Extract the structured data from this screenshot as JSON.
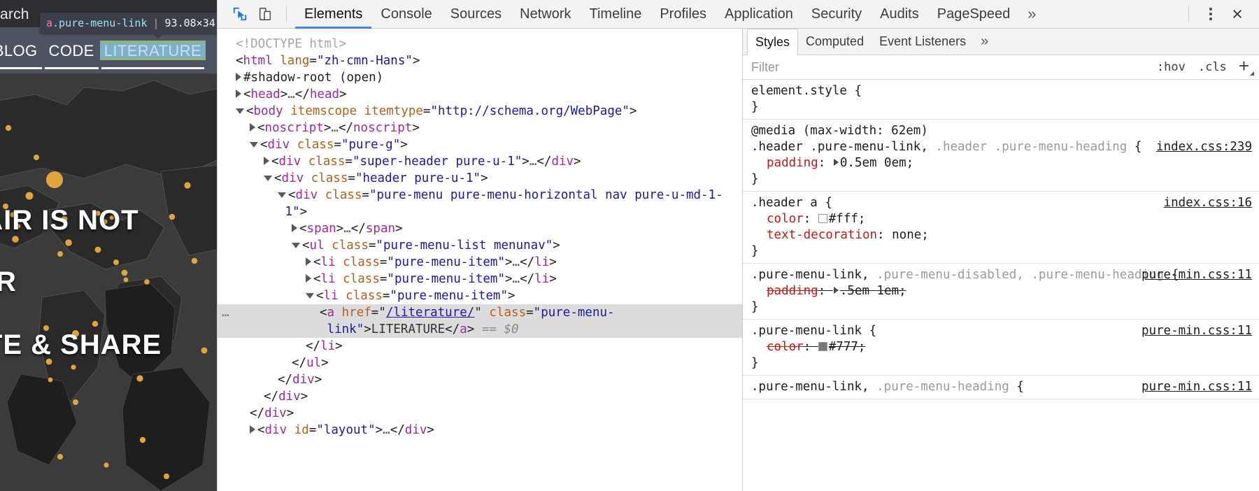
{
  "viewport": {
    "topbar": {
      "search_label": "arch"
    },
    "inspector_tooltip": {
      "tag": "a",
      "classname": ".pure-menu-link",
      "separator": "|",
      "size": "93.08×34"
    },
    "nav": [
      {
        "label": "BLOG",
        "highlighted": false
      },
      {
        "label": "CODE",
        "highlighted": false
      },
      {
        "label": "LITERATURE",
        "highlighted": true
      }
    ],
    "hero": {
      "line1": "FAIR IS NOT",
      "line2": "AIR",
      "line3": "ATE & SHARE"
    }
  },
  "devtools": {
    "toolbar": {
      "inspect_icon": "cursor-select-icon",
      "device_icon": "device-toolbar-icon",
      "tabs": [
        {
          "label": "Elements",
          "active": true
        },
        {
          "label": "Console",
          "active": false
        },
        {
          "label": "Sources",
          "active": false
        },
        {
          "label": "Network",
          "active": false
        },
        {
          "label": "Timeline",
          "active": false
        },
        {
          "label": "Profiles",
          "active": false
        },
        {
          "label": "Application",
          "active": false
        },
        {
          "label": "Security",
          "active": false
        },
        {
          "label": "Audits",
          "active": false
        },
        {
          "label": "PageSpeed",
          "active": false
        }
      ],
      "more_tabs": "»",
      "menu_icon": "kebab-menu-icon",
      "close_icon": "×"
    },
    "dom_tree": [
      {
        "indent": 0,
        "twisty": "none",
        "parts": [
          {
            "t": "doctype",
            "v": "<!DOCTYPE html>"
          }
        ]
      },
      {
        "indent": 0,
        "twisty": "none",
        "parts": [
          {
            "t": "punc",
            "v": "<"
          },
          {
            "t": "tag",
            "v": "html"
          },
          {
            "t": "sp",
            "v": " "
          },
          {
            "t": "attr",
            "v": "lang"
          },
          {
            "t": "punc",
            "v": "="
          },
          {
            "t": "val",
            "v": "\"zh-cmn-Hans\""
          },
          {
            "t": "punc",
            "v": ">"
          }
        ]
      },
      {
        "indent": 0,
        "twisty": "closed",
        "parts": [
          {
            "t": "plain",
            "v": "#shadow-root (open)"
          }
        ]
      },
      {
        "indent": 0,
        "twisty": "closed",
        "parts": [
          {
            "t": "punc",
            "v": "<"
          },
          {
            "t": "tag",
            "v": "head"
          },
          {
            "t": "punc",
            "v": ">"
          },
          {
            "t": "dots",
            "v": "…"
          },
          {
            "t": "punc",
            "v": "</"
          },
          {
            "t": "tag",
            "v": "head"
          },
          {
            "t": "punc",
            "v": ">"
          }
        ]
      },
      {
        "indent": 0,
        "twisty": "open",
        "parts": [
          {
            "t": "punc",
            "v": "<"
          },
          {
            "t": "tag",
            "v": "body"
          },
          {
            "t": "sp",
            "v": " "
          },
          {
            "t": "attr",
            "v": "itemscope"
          },
          {
            "t": "sp",
            "v": " "
          },
          {
            "t": "attr",
            "v": "itemtype"
          },
          {
            "t": "punc",
            "v": "="
          },
          {
            "t": "val",
            "v": "\"http://schema.org/WebPage\""
          },
          {
            "t": "punc",
            "v": ">"
          }
        ]
      },
      {
        "indent": 1,
        "twisty": "closed",
        "parts": [
          {
            "t": "punc",
            "v": "<"
          },
          {
            "t": "tag",
            "v": "noscript"
          },
          {
            "t": "punc",
            "v": ">"
          },
          {
            "t": "dots",
            "v": "…"
          },
          {
            "t": "punc",
            "v": "</"
          },
          {
            "t": "tag",
            "v": "noscript"
          },
          {
            "t": "punc",
            "v": ">"
          }
        ]
      },
      {
        "indent": 1,
        "twisty": "open",
        "parts": [
          {
            "t": "punc",
            "v": "<"
          },
          {
            "t": "tag",
            "v": "div"
          },
          {
            "t": "sp",
            "v": " "
          },
          {
            "t": "attr",
            "v": "class"
          },
          {
            "t": "punc",
            "v": "="
          },
          {
            "t": "val",
            "v": "\"pure-g\""
          },
          {
            "t": "punc",
            "v": ">"
          }
        ]
      },
      {
        "indent": 2,
        "twisty": "closed",
        "parts": [
          {
            "t": "punc",
            "v": "<"
          },
          {
            "t": "tag",
            "v": "div"
          },
          {
            "t": "sp",
            "v": " "
          },
          {
            "t": "attr",
            "v": "class"
          },
          {
            "t": "punc",
            "v": "="
          },
          {
            "t": "val",
            "v": "\"super-header pure-u-1\""
          },
          {
            "t": "punc",
            "v": ">"
          },
          {
            "t": "dots",
            "v": "…"
          },
          {
            "t": "punc",
            "v": "</"
          },
          {
            "t": "tag",
            "v": "div"
          },
          {
            "t": "punc",
            "v": ">"
          }
        ]
      },
      {
        "indent": 2,
        "twisty": "open",
        "parts": [
          {
            "t": "punc",
            "v": "<"
          },
          {
            "t": "tag",
            "v": "div"
          },
          {
            "t": "sp",
            "v": " "
          },
          {
            "t": "attr",
            "v": "class"
          },
          {
            "t": "punc",
            "v": "="
          },
          {
            "t": "val",
            "v": "\"header pure-u-1\""
          },
          {
            "t": "punc",
            "v": ">"
          }
        ]
      },
      {
        "indent": 3,
        "twisty": "open",
        "parts": [
          {
            "t": "punc",
            "v": "<"
          },
          {
            "t": "tag",
            "v": "div"
          },
          {
            "t": "sp",
            "v": " "
          },
          {
            "t": "attr",
            "v": "class"
          },
          {
            "t": "punc",
            "v": "="
          },
          {
            "t": "val",
            "v": "\"pure-menu pure-menu-horizontal nav pure-u-md-1-"
          },
          {
            "t": "wrap",
            "v": ""
          },
          {
            "t": "val",
            "v": "1\""
          },
          {
            "t": "punc",
            "v": ">"
          }
        ]
      },
      {
        "indent": 4,
        "twisty": "closed",
        "parts": [
          {
            "t": "punc",
            "v": "<"
          },
          {
            "t": "tag",
            "v": "span"
          },
          {
            "t": "punc",
            "v": ">"
          },
          {
            "t": "dots",
            "v": "…"
          },
          {
            "t": "punc",
            "v": "</"
          },
          {
            "t": "tag",
            "v": "span"
          },
          {
            "t": "punc",
            "v": ">"
          }
        ]
      },
      {
        "indent": 4,
        "twisty": "open",
        "parts": [
          {
            "t": "punc",
            "v": "<"
          },
          {
            "t": "tag",
            "v": "ul"
          },
          {
            "t": "sp",
            "v": " "
          },
          {
            "t": "attr",
            "v": "class"
          },
          {
            "t": "punc",
            "v": "="
          },
          {
            "t": "val",
            "v": "\"pure-menu-list menunav\""
          },
          {
            "t": "punc",
            "v": ">"
          }
        ]
      },
      {
        "indent": 5,
        "twisty": "closed",
        "parts": [
          {
            "t": "punc",
            "v": "<"
          },
          {
            "t": "tag",
            "v": "li"
          },
          {
            "t": "sp",
            "v": " "
          },
          {
            "t": "attr",
            "v": "class"
          },
          {
            "t": "punc",
            "v": "="
          },
          {
            "t": "val",
            "v": "\"pure-menu-item\""
          },
          {
            "t": "punc",
            "v": ">"
          },
          {
            "t": "dots",
            "v": "…"
          },
          {
            "t": "punc",
            "v": "</"
          },
          {
            "t": "tag",
            "v": "li"
          },
          {
            "t": "punc",
            "v": ">"
          }
        ]
      },
      {
        "indent": 5,
        "twisty": "closed",
        "parts": [
          {
            "t": "punc",
            "v": "<"
          },
          {
            "t": "tag",
            "v": "li"
          },
          {
            "t": "sp",
            "v": " "
          },
          {
            "t": "attr",
            "v": "class"
          },
          {
            "t": "punc",
            "v": "="
          },
          {
            "t": "val",
            "v": "\"pure-menu-item\""
          },
          {
            "t": "punc",
            "v": ">"
          },
          {
            "t": "dots",
            "v": "…"
          },
          {
            "t": "punc",
            "v": "</"
          },
          {
            "t": "tag",
            "v": "li"
          },
          {
            "t": "punc",
            "v": ">"
          }
        ]
      },
      {
        "indent": 5,
        "twisty": "open",
        "parts": [
          {
            "t": "punc",
            "v": "<"
          },
          {
            "t": "tag",
            "v": "li"
          },
          {
            "t": "sp",
            "v": " "
          },
          {
            "t": "attr",
            "v": "class"
          },
          {
            "t": "punc",
            "v": "="
          },
          {
            "t": "val",
            "v": "\"pure-menu-item\""
          },
          {
            "t": "punc",
            "v": ">"
          }
        ]
      },
      {
        "indent": 6,
        "twisty": "none",
        "selected": true,
        "marker": "…",
        "parts": [
          {
            "t": "punc",
            "v": "<"
          },
          {
            "t": "tag",
            "v": "a"
          },
          {
            "t": "sp",
            "v": " "
          },
          {
            "t": "attr",
            "v": "href"
          },
          {
            "t": "punc",
            "v": "="
          },
          {
            "t": "punc",
            "v": "\""
          },
          {
            "t": "link",
            "v": "/literature/"
          },
          {
            "t": "punc",
            "v": "\""
          },
          {
            "t": "sp",
            "v": " "
          },
          {
            "t": "attr",
            "v": "class"
          },
          {
            "t": "punc",
            "v": "="
          },
          {
            "t": "val",
            "v": "\"pure-menu-"
          },
          {
            "t": "wrap2",
            "v": ""
          },
          {
            "t": "val",
            "v": "link\""
          },
          {
            "t": "punc",
            "v": ">"
          },
          {
            "t": "text",
            "v": "LITERATURE"
          },
          {
            "t": "punc",
            "v": "</"
          },
          {
            "t": "tag",
            "v": "a"
          },
          {
            "t": "punc",
            "v": ">"
          },
          {
            "t": "dollar",
            "v": " == $0"
          }
        ]
      },
      {
        "indent": 5,
        "twisty": "none",
        "parts": [
          {
            "t": "punc",
            "v": "</"
          },
          {
            "t": "tag",
            "v": "li"
          },
          {
            "t": "punc",
            "v": ">"
          }
        ]
      },
      {
        "indent": 4,
        "twisty": "none",
        "parts": [
          {
            "t": "punc",
            "v": "</"
          },
          {
            "t": "tag",
            "v": "ul"
          },
          {
            "t": "punc",
            "v": ">"
          }
        ]
      },
      {
        "indent": 3,
        "twisty": "none",
        "parts": [
          {
            "t": "punc",
            "v": "</"
          },
          {
            "t": "tag",
            "v": "div"
          },
          {
            "t": "punc",
            "v": ">"
          }
        ]
      },
      {
        "indent": 2,
        "twisty": "none",
        "parts": [
          {
            "t": "punc",
            "v": "</"
          },
          {
            "t": "tag",
            "v": "div"
          },
          {
            "t": "punc",
            "v": ">"
          }
        ]
      },
      {
        "indent": 1,
        "twisty": "none",
        "parts": [
          {
            "t": "punc",
            "v": "</"
          },
          {
            "t": "tag",
            "v": "div"
          },
          {
            "t": "punc",
            "v": ">"
          }
        ]
      },
      {
        "indent": 1,
        "twisty": "closed",
        "parts": [
          {
            "t": "punc",
            "v": "<"
          },
          {
            "t": "tag",
            "v": "div"
          },
          {
            "t": "sp",
            "v": " "
          },
          {
            "t": "attr",
            "v": "id"
          },
          {
            "t": "punc",
            "v": "="
          },
          {
            "t": "val",
            "v": "\"layout\""
          },
          {
            "t": "punc",
            "v": ">"
          },
          {
            "t": "dots",
            "v": "…"
          },
          {
            "t": "punc",
            "v": "</"
          },
          {
            "t": "tag",
            "v": "div"
          },
          {
            "t": "punc",
            "v": ">"
          }
        ]
      }
    ],
    "styles": {
      "tabs": [
        {
          "label": "Styles",
          "active": true
        },
        {
          "label": "Computed",
          "active": false
        },
        {
          "label": "Event Listeners",
          "active": false
        }
      ],
      "more_tabs": "»",
      "filter_placeholder": "Filter",
      "hov_label": ":hov",
      "cls_label": ".cls",
      "plus_label": "+",
      "rules": [
        {
          "id": "element-style",
          "selector_parts": [
            {
              "t": "main",
              "v": "element.style"
            }
          ],
          "source": "",
          "declarations": []
        },
        {
          "id": "media-header-pure-menu-link",
          "media": "@media (max-width: 62em)",
          "selector_parts": [
            {
              "t": "main",
              "v": ".header .pure-menu-link"
            },
            {
              "t": "main",
              "v": ", "
            },
            {
              "t": "dim",
              "v": ".header .pure-menu-heading"
            }
          ],
          "source": "index.css:239",
          "declarations": [
            {
              "prop": "padding",
              "value": "0.5em 0em;",
              "triangle": true,
              "struck": false,
              "swatch": null
            }
          ]
        },
        {
          "id": "header-a",
          "media": "",
          "selector_parts": [
            {
              "t": "main",
              "v": ".header a"
            }
          ],
          "source": "index.css:16",
          "declarations": [
            {
              "prop": "color",
              "value": "#fff;",
              "triangle": false,
              "struck": false,
              "swatch": "#ffffff"
            },
            {
              "prop": "text-decoration",
              "value": "none;",
              "triangle": false,
              "struck": false,
              "swatch": null
            }
          ]
        },
        {
          "id": "pure-menu-link-disabled-heading",
          "media": "",
          "selector_parts": [
            {
              "t": "main",
              "v": ".pure-menu-link"
            },
            {
              "t": "main",
              "v": ", "
            },
            {
              "t": "dim",
              "v": ".pure-menu-disabled, .pure-menu-heading"
            }
          ],
          "source": "pure-min.css:11",
          "declarations": [
            {
              "prop": "padding",
              "value": ".5em 1em;",
              "triangle": true,
              "struck": true,
              "swatch": null
            }
          ]
        },
        {
          "id": "pure-menu-link",
          "media": "",
          "selector_parts": [
            {
              "t": "main",
              "v": ".pure-menu-link"
            }
          ],
          "source": "pure-min.css:11",
          "declarations": [
            {
              "prop": "color",
              "value": "#777;",
              "triangle": false,
              "struck": true,
              "swatch": "#777777"
            }
          ]
        },
        {
          "id": "pure-menu-link-heading",
          "media": "",
          "selector_parts": [
            {
              "t": "main",
              "v": ".pure-menu-link"
            },
            {
              "t": "main",
              "v": ", "
            },
            {
              "t": "dim",
              "v": ".pure-menu-heading"
            }
          ],
          "source": "pure-min.css:11",
          "declarations": []
        }
      ]
    }
  }
}
